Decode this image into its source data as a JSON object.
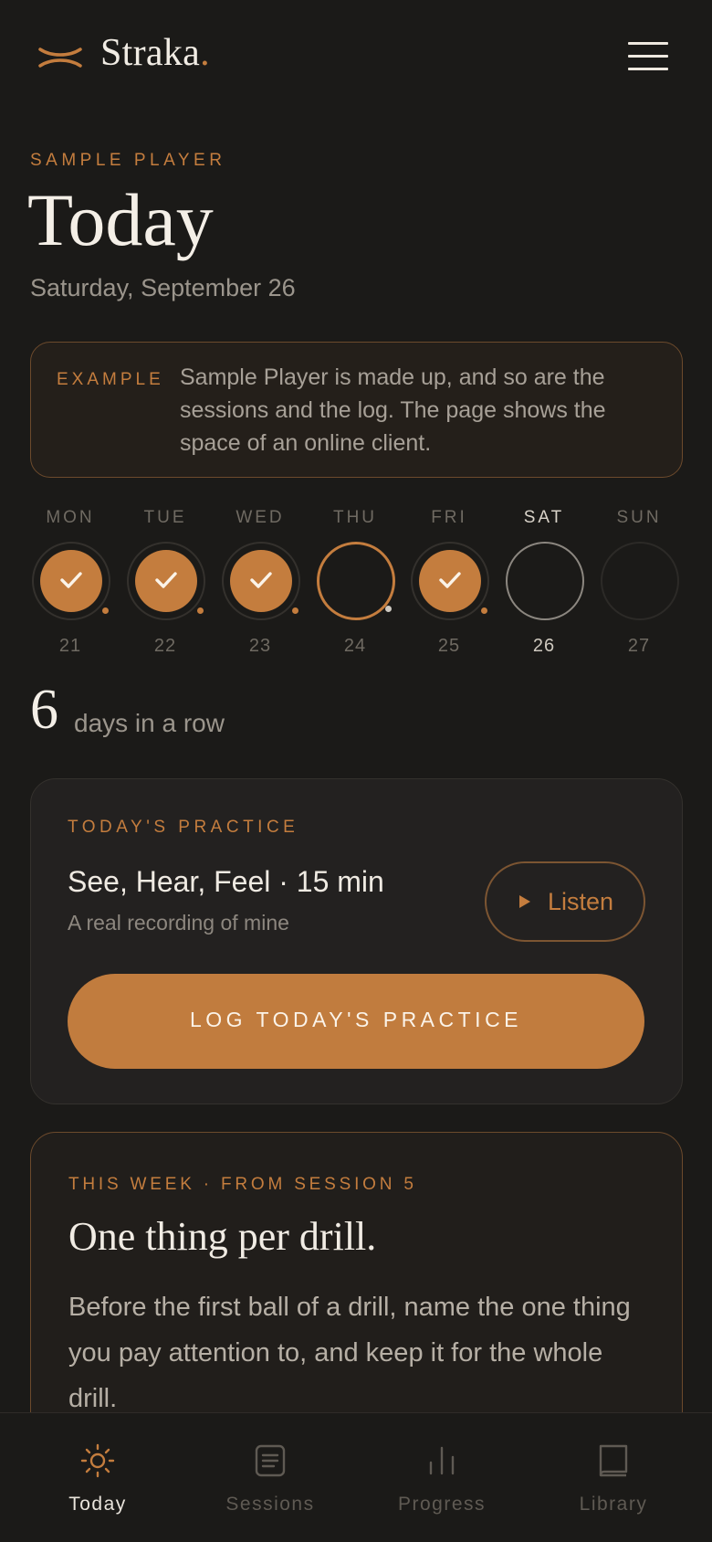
{
  "brand": {
    "name": "Straka",
    "dot": ".",
    "accent": "#c47d3e"
  },
  "header": {
    "menu_icon": "hamburger-icon"
  },
  "page": {
    "eyebrow": "SAMPLE PLAYER",
    "title": "Today",
    "date": "Saturday, September 26"
  },
  "notice": {
    "label": "EXAMPLE",
    "text": "Sample Player is made up, and so are the sessions and the log. The page shows the space of an online client."
  },
  "week": {
    "days": [
      {
        "name": "MON",
        "num": "21",
        "status": "done"
      },
      {
        "name": "TUE",
        "num": "22",
        "status": "done"
      },
      {
        "name": "WED",
        "num": "23",
        "status": "done"
      },
      {
        "name": "THU",
        "num": "24",
        "status": "missed"
      },
      {
        "name": "FRI",
        "num": "25",
        "status": "done"
      },
      {
        "name": "SAT",
        "num": "26",
        "status": "today"
      },
      {
        "name": "SUN",
        "num": "27",
        "status": "future"
      }
    ]
  },
  "streak": {
    "count": "6",
    "label": "days in a row"
  },
  "practice": {
    "eyebrow": "TODAY'S PRACTICE",
    "title": "See, Hear, Feel · 15 min",
    "subtitle": "A real recording of mine",
    "listen_label": "Listen",
    "log_label": "LOG TODAY'S PRACTICE"
  },
  "lesson": {
    "eyebrow": "THIS WEEK · FROM SESSION 5",
    "title": "One thing per drill.",
    "body": "Before the first ball of a drill, name the one thing you pay attention to, and keep it for the whole drill."
  },
  "tabs": [
    {
      "label": "Today",
      "icon": "sun-icon",
      "active": true
    },
    {
      "label": "Sessions",
      "icon": "document-icon",
      "active": false
    },
    {
      "label": "Progress",
      "icon": "bar-chart-icon",
      "active": false
    },
    {
      "label": "Library",
      "icon": "book-icon",
      "active": false
    }
  ]
}
